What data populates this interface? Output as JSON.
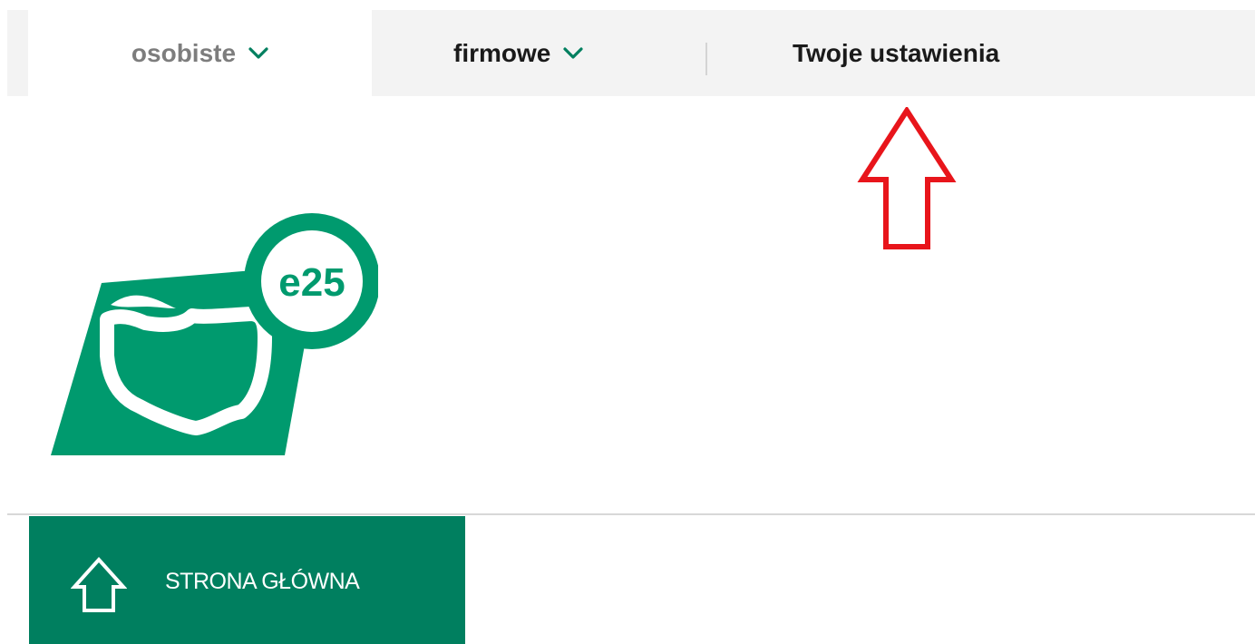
{
  "top_nav": {
    "tabs": [
      {
        "label": "osobiste",
        "active": true
      },
      {
        "label": "firmowe",
        "active": false
      }
    ],
    "settings_label": "Twoje ustawienia"
  },
  "logo": {
    "text": "e25",
    "brand_color": "#009a6e"
  },
  "main_nav": {
    "home_label": "STRONA GŁÓWNA",
    "home_bg": "#007f5f"
  },
  "annotation": {
    "arrow_color": "#e8151b"
  },
  "icons": [
    "chevron-down-icon",
    "home-icon",
    "red-up-arrow-annotation"
  ]
}
